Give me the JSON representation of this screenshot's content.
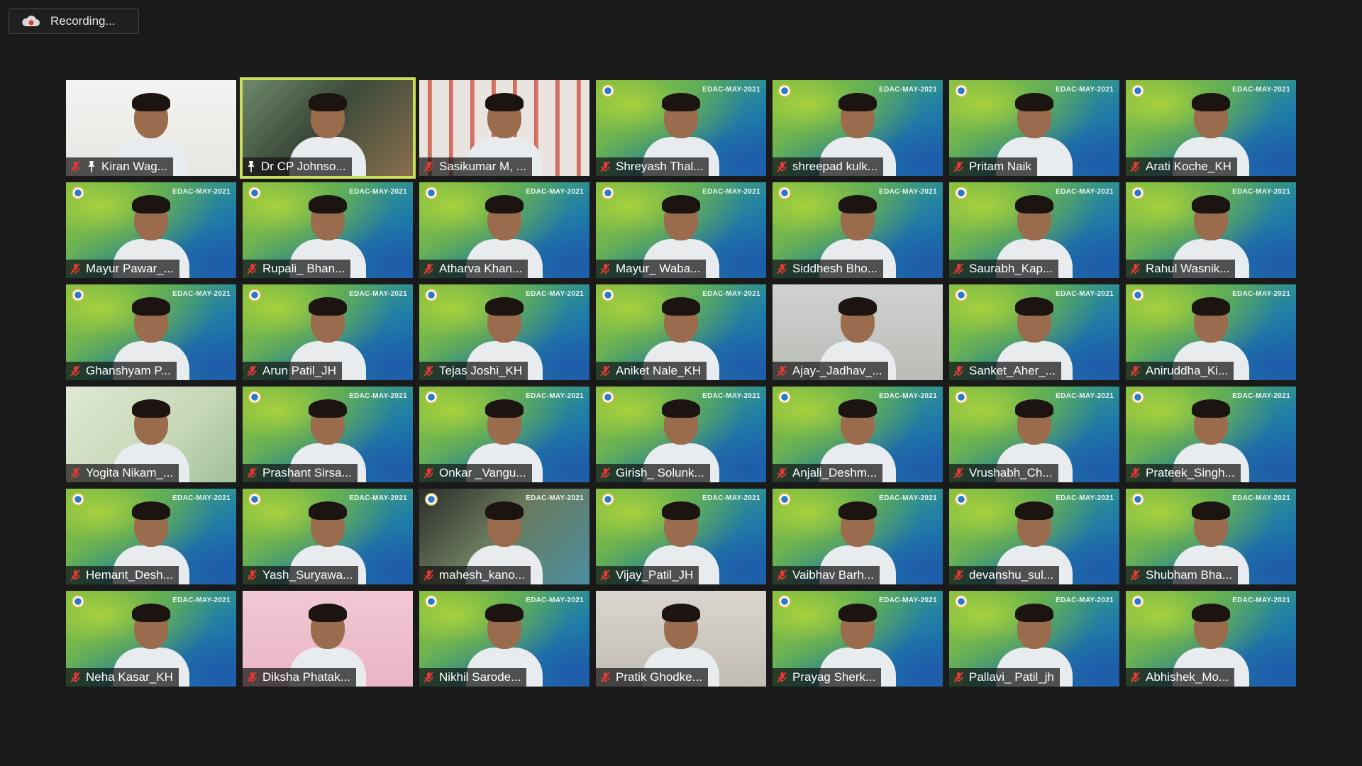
{
  "recording": {
    "label": "Recording..."
  },
  "active_speaker_index": 1,
  "participants": [
    {
      "name": "Kiran Wag...",
      "muted": true,
      "pinned": true,
      "bg": "white",
      "watermark": ""
    },
    {
      "name": "Dr CP Johnso...",
      "muted": false,
      "pinned": true,
      "bg": "room",
      "watermark": ""
    },
    {
      "name": "Sasikumar M, ...",
      "muted": true,
      "pinned": false,
      "bg": "curtain",
      "watermark": ""
    },
    {
      "name": "Shreyash Thal...",
      "muted": true,
      "pinned": false,
      "bg": "virtual",
      "watermark": "EDAC-MAY-2021"
    },
    {
      "name": "shreepad kulk...",
      "muted": true,
      "pinned": false,
      "bg": "virtual",
      "watermark": "EDAC-MAY-2021"
    },
    {
      "name": "Pritam Naik",
      "muted": true,
      "pinned": false,
      "bg": "virtual",
      "watermark": "EDAC-MAY-2021"
    },
    {
      "name": "Arati Koche_KH",
      "muted": true,
      "pinned": false,
      "bg": "virtual",
      "watermark": "EDAC-MAY-2021"
    },
    {
      "name": "Mayur Pawar_...",
      "muted": true,
      "pinned": false,
      "bg": "virtual",
      "watermark": "EDAC-MAY-2021"
    },
    {
      "name": "Rupali_ Bhan...",
      "muted": true,
      "pinned": false,
      "bg": "virtual",
      "watermark": "EDAC-MAY-2021"
    },
    {
      "name": "Atharva Khan...",
      "muted": true,
      "pinned": false,
      "bg": "virtual",
      "watermark": "EDAC-MAY-2021"
    },
    {
      "name": "Mayur_ Waba...",
      "muted": true,
      "pinned": false,
      "bg": "virtual",
      "watermark": "EDAC-MAY-2021"
    },
    {
      "name": "Siddhesh Bho...",
      "muted": true,
      "pinned": false,
      "bg": "virtual",
      "watermark": "EDAC-MAY-2021"
    },
    {
      "name": "Saurabh_Kap...",
      "muted": true,
      "pinned": false,
      "bg": "virtual",
      "watermark": "EDAC-MAY-2021"
    },
    {
      "name": "Rahul Wasnik...",
      "muted": true,
      "pinned": false,
      "bg": "virtual",
      "watermark": "EDAC-MAY-2021"
    },
    {
      "name": "Ghanshyam P...",
      "muted": true,
      "pinned": false,
      "bg": "virtual",
      "watermark": "EDAC-MAY-2021"
    },
    {
      "name": "Arun Patil_JH",
      "muted": true,
      "pinned": false,
      "bg": "virtual",
      "watermark": "EDAC-MAY-2021"
    },
    {
      "name": "Tejas Joshi_KH",
      "muted": true,
      "pinned": false,
      "bg": "virtual",
      "watermark": "EDAC-MAY-2021"
    },
    {
      "name": "Aniket Nale_KH",
      "muted": true,
      "pinned": false,
      "bg": "virtual",
      "watermark": "EDAC-MAY-2021"
    },
    {
      "name": "Ajay-_Jadhav_...",
      "muted": true,
      "pinned": false,
      "bg": "plain",
      "watermark": ""
    },
    {
      "name": "Sanket_Aher_...",
      "muted": true,
      "pinned": false,
      "bg": "virtual",
      "watermark": "EDAC-MAY-2021"
    },
    {
      "name": "Aniruddha_Ki...",
      "muted": true,
      "pinned": false,
      "bg": "virtual",
      "watermark": "EDAC-MAY-2021"
    },
    {
      "name": "Yogita Nikam_...",
      "muted": true,
      "pinned": false,
      "bg": "lightgreen",
      "watermark": ""
    },
    {
      "name": "Prashant Sirsa...",
      "muted": true,
      "pinned": false,
      "bg": "virtual",
      "watermark": "EDAC-MAY-2021"
    },
    {
      "name": "Onkar _Vangu...",
      "muted": true,
      "pinned": false,
      "bg": "virtual",
      "watermark": "EDAC-MAY-2021"
    },
    {
      "name": "Girish_ Solunk...",
      "muted": true,
      "pinned": false,
      "bg": "virtual",
      "watermark": "EDAC-MAY-2021"
    },
    {
      "name": "Anjali_Deshm...",
      "muted": true,
      "pinned": false,
      "bg": "virtual",
      "watermark": "EDAC-MAY-2021"
    },
    {
      "name": "Vrushabh_Ch...",
      "muted": true,
      "pinned": false,
      "bg": "virtual",
      "watermark": "EDAC-MAY-2021"
    },
    {
      "name": "Prateek_Singh...",
      "muted": true,
      "pinned": false,
      "bg": "virtual",
      "watermark": "EDAC-MAY-2021"
    },
    {
      "name": "Hemant_Desh...",
      "muted": true,
      "pinned": false,
      "bg": "virtual",
      "watermark": "EDAC-MAY-2021"
    },
    {
      "name": "Yash_Suryawa...",
      "muted": true,
      "pinned": false,
      "bg": "virtual",
      "watermark": "EDAC-MAY-2021"
    },
    {
      "name": "mahesh_kano...",
      "muted": true,
      "pinned": false,
      "bg": "dark",
      "watermark": "EDAC-MAY-2021"
    },
    {
      "name": "Vijay_Patil_JH",
      "muted": true,
      "pinned": false,
      "bg": "virtual",
      "watermark": "EDAC-MAY-2021"
    },
    {
      "name": "Vaibhav Barh...",
      "muted": true,
      "pinned": false,
      "bg": "virtual",
      "watermark": "EDAC-MAY-2021"
    },
    {
      "name": "devanshu_sul...",
      "muted": true,
      "pinned": false,
      "bg": "virtual",
      "watermark": "EDAC-MAY-2021"
    },
    {
      "name": "Shubham Bha...",
      "muted": true,
      "pinned": false,
      "bg": "virtual",
      "watermark": "EDAC-MAY-2021"
    },
    {
      "name": "Neha Kasar_KH",
      "muted": true,
      "pinned": false,
      "bg": "virtual",
      "watermark": "EDAC-MAY-2021"
    },
    {
      "name": "Diksha Phatak...",
      "muted": true,
      "pinned": false,
      "bg": "pink",
      "watermark": ""
    },
    {
      "name": "Nikhil Sarode...",
      "muted": true,
      "pinned": false,
      "bg": "virtual",
      "watermark": "EDAC-MAY-2021"
    },
    {
      "name": "Pratik Ghodke...",
      "muted": true,
      "pinned": false,
      "bg": "greywall",
      "watermark": ""
    },
    {
      "name": "Prayag Sherk...",
      "muted": true,
      "pinned": false,
      "bg": "virtual",
      "watermark": "EDAC-MAY-2021"
    },
    {
      "name": "Pallavi_ Patil_jh",
      "muted": true,
      "pinned": false,
      "bg": "virtual",
      "watermark": "EDAC-MAY-2021"
    },
    {
      "name": "Abhishek_Mo...",
      "muted": true,
      "pinned": false,
      "bg": "virtual",
      "watermark": "EDAC-MAY-2021"
    }
  ],
  "colors": {
    "background": "#1a1a1a",
    "active_border": "#c9df5a",
    "muted_icon": "#e53935",
    "nameplate_text": "#ffffff"
  },
  "icons": {
    "recording": "cloud-record-icon",
    "muted": "microphone-muted-icon",
    "pinned": "pin-icon",
    "logo": "cdac-logo-icon"
  }
}
